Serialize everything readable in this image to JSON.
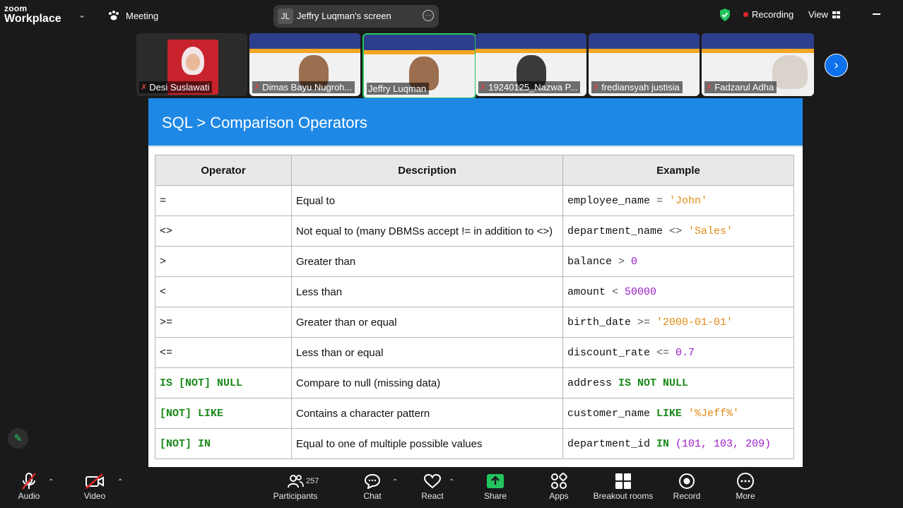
{
  "app": {
    "brand_top": "zoom",
    "brand_bottom": "Workplace",
    "meeting_label": "Meeting"
  },
  "screen_share": {
    "initials": "JL",
    "label": "Jeffry Luqman's screen"
  },
  "recording": {
    "label": "Recording"
  },
  "view": {
    "label": "View"
  },
  "participants_tiles": [
    {
      "name": "Desi Suslawati"
    },
    {
      "name": "Dimas Bayu Nugroh..."
    },
    {
      "name": "Jeffry Luqman"
    },
    {
      "name": "19240125_Nazwa P..."
    },
    {
      "name": "frediansyah justisia"
    },
    {
      "name": "Fadzarul Adha"
    }
  ],
  "slide": {
    "title": "SQL > Comparison Operators",
    "headers": [
      "Operator",
      "Description",
      "Example"
    ],
    "rows": [
      {
        "op": "=",
        "desc": "Equal to",
        "ex": [
          "employee_name",
          " = ",
          "'John'"
        ]
      },
      {
        "op": "<>",
        "desc": "Not equal to (many DBMSs accept != in addition to <>)",
        "ex": [
          "department_name",
          " <> ",
          "'Sales'"
        ]
      },
      {
        "op": ">",
        "desc": "Greater than",
        "ex": [
          "balance",
          " > ",
          "0"
        ]
      },
      {
        "op": "<",
        "desc": "Less than",
        "ex": [
          "amount",
          " < ",
          "50000"
        ]
      },
      {
        "op": ">=",
        "desc": "Greater than or equal",
        "ex": [
          "birth_date",
          " >= ",
          "'2000-01-01'"
        ]
      },
      {
        "op": "<=",
        "desc": "Less than or equal",
        "ex": [
          "discount_rate",
          " <= ",
          "0.7"
        ]
      },
      {
        "op": "IS [NOT] NULL",
        "desc": "Compare to null (missing data)",
        "ex": [
          "address",
          " IS NOT NULL",
          ""
        ]
      },
      {
        "op": "[NOT] LIKE",
        "desc": "Contains a character pattern",
        "ex": [
          "customer_name",
          " LIKE ",
          "'%Jeff%'"
        ]
      },
      {
        "op": "[NOT] IN",
        "desc": "Equal to one of multiple possible values",
        "ex": [
          "department_id",
          " IN ",
          "(101, 103, 209)"
        ]
      }
    ]
  },
  "toolbar": {
    "audio": "Audio",
    "video": "Video",
    "participants": "Participants",
    "participants_count": "257",
    "chat": "Chat",
    "react": "React",
    "share": "Share",
    "apps": "Apps",
    "breakout": "Breakout rooms",
    "record": "Record",
    "more": "More"
  },
  "colors": {
    "accent_blue": "#1e88e5",
    "share_green": "#22c55e",
    "record_red": "#e02828",
    "keyword_green": "#1a8a1a",
    "string_orange": "#e08a14",
    "number_purple": "#9b1ec8"
  }
}
